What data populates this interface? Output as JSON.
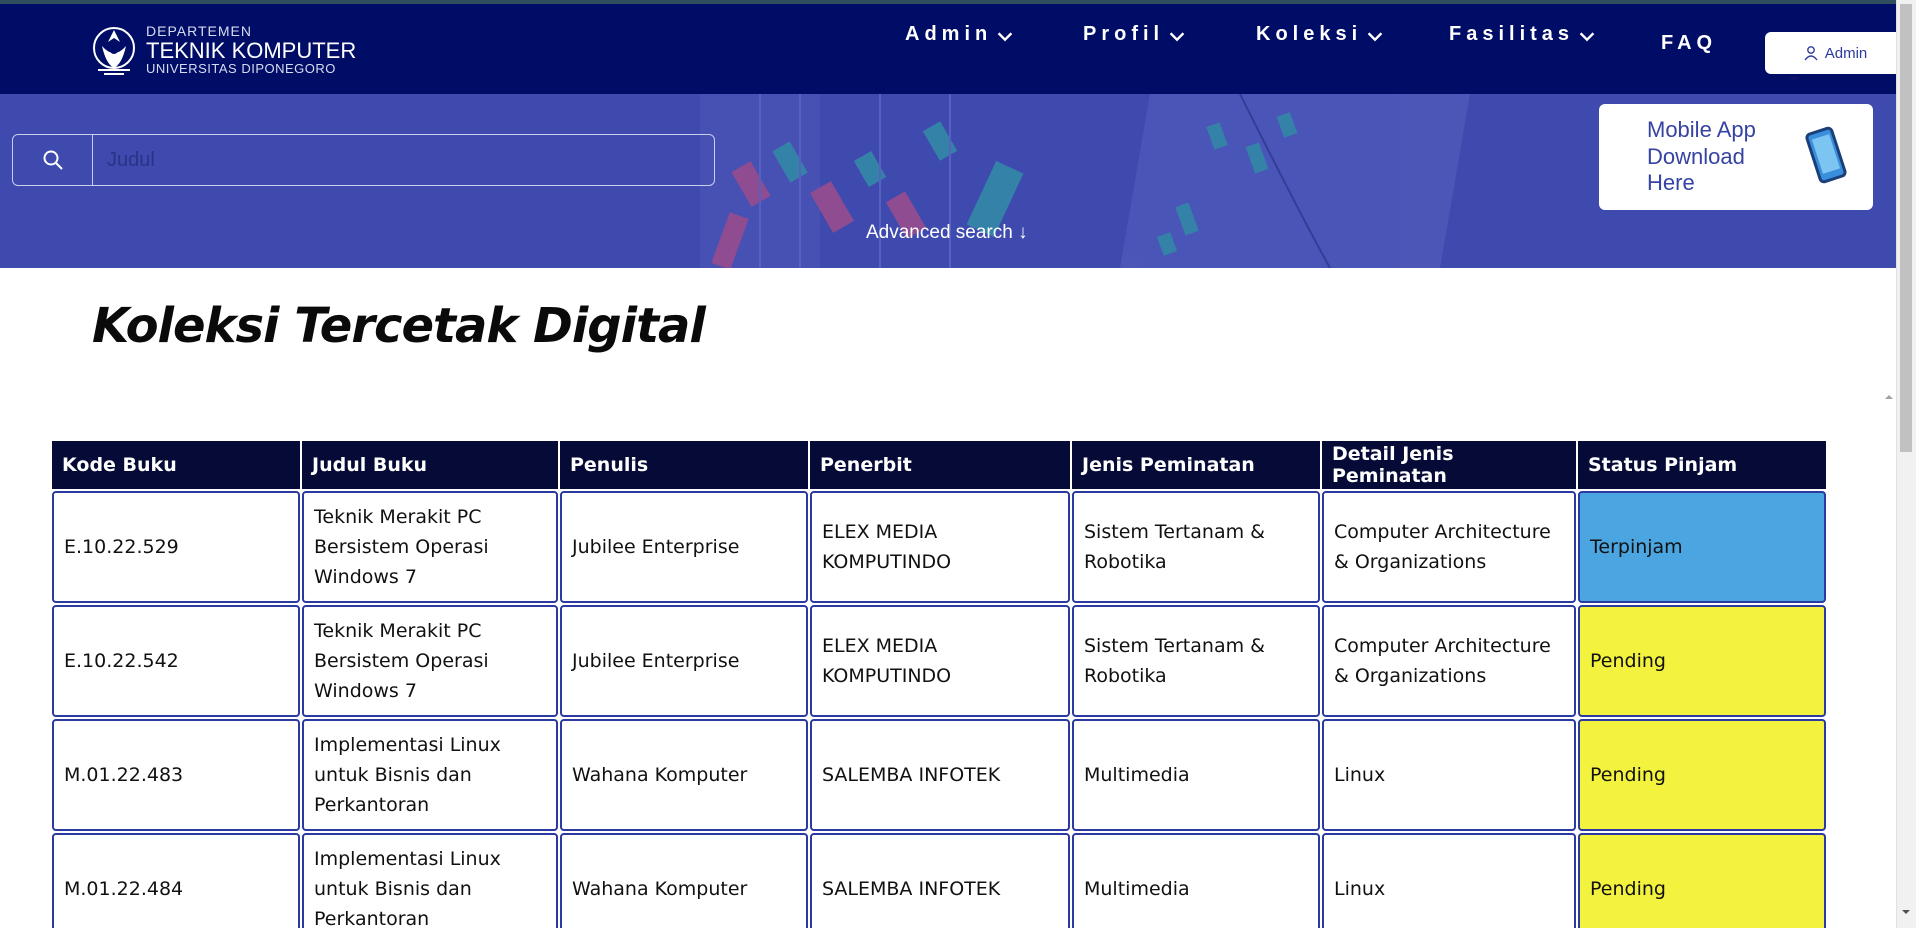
{
  "logo": {
    "line1": "DEPARTEMEN",
    "line2": "TEKNIK KOMPUTER",
    "line3": "UNIVERSITAS DIPONEGORO"
  },
  "nav": {
    "items": [
      {
        "label": "Admin",
        "has_dropdown": true
      },
      {
        "label": "Profil",
        "has_dropdown": true
      },
      {
        "label": "Koleksi",
        "has_dropdown": true
      },
      {
        "label": "Fasilitas",
        "has_dropdown": true
      },
      {
        "label": "FAQ",
        "has_dropdown": false
      }
    ],
    "user_button": {
      "label": "Admin",
      "icon": "user-icon"
    }
  },
  "search": {
    "placeholder": "Judul",
    "icon": "search-icon",
    "advanced_label": "Advanced search ↓"
  },
  "mobile_app": {
    "label": "Mobile App Download Here",
    "icon": "phone-icon"
  },
  "page_title": "Koleksi Tercetak Digital",
  "table": {
    "headers": [
      "Kode Buku",
      "Judul Buku",
      "Penulis",
      "Penerbit",
      "Jenis Peminatan",
      "Detail Jenis Peminatan",
      "Status Pinjam"
    ],
    "rows": [
      {
        "kode": "E.10.22.529",
        "judul": "Teknik Merakit PC Bersistem Operasi Windows 7",
        "penulis": "Jubilee Enterprise",
        "penerbit": "ELEX MEDIA KOMPUTINDO",
        "jenis": "Sistem Tertanam & Robotika",
        "detail": "Computer Architecture & Organizations",
        "status": "Terpinjam"
      },
      {
        "kode": "E.10.22.542",
        "judul": "Teknik Merakit PC Bersistem Operasi Windows 7",
        "penulis": "Jubilee Enterprise",
        "penerbit": "ELEX MEDIA KOMPUTINDO",
        "jenis": "Sistem Tertanam & Robotika",
        "detail": "Computer Architecture & Organizations",
        "status": "Pending"
      },
      {
        "kode": "M.01.22.483",
        "judul": "Implementasi Linux untuk Bisnis dan Perkantoran",
        "penulis": "Wahana Komputer",
        "penerbit": "SALEMBA INFOTEK",
        "jenis": "Multimedia",
        "detail": "Linux",
        "status": "Pending"
      },
      {
        "kode": "M.01.22.484",
        "judul": "Implementasi Linux untuk Bisnis dan Perkantoran",
        "penulis": "Wahana Komputer",
        "penerbit": "SALEMBA INFOTEK",
        "jenis": "Multimedia",
        "detail": "Linux",
        "status": "Pending"
      }
    ]
  },
  "colors": {
    "header_bg": "#000d66",
    "hero_bg": "#3e4aad",
    "table_head_bg": "#050b36",
    "cell_border": "#2b3aa0",
    "status_terpinjam": "#4aa5e0",
    "status_pending": "#f2f23f"
  }
}
